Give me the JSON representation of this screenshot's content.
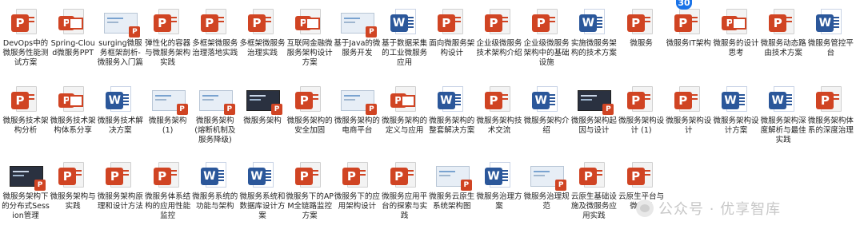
{
  "files": [
    {
      "label": "DevOps中的微服务性能测试方案",
      "type": "ppt"
    },
    {
      "label": "Spring-Cloud微服务PPT",
      "type": "pslide"
    },
    {
      "label": "surging微服务框架剖析-微服务入门篇",
      "type": "thumb-light"
    },
    {
      "label": "弹性化的容器与微服务架构实践",
      "type": "ppt"
    },
    {
      "label": "多框架微服务治理落地实践",
      "type": "ppt"
    },
    {
      "label": "多框架微服务治理实践",
      "type": "ppt"
    },
    {
      "label": "互联网金融微服务架构设计方案",
      "type": "pslide"
    },
    {
      "label": "基于Java的微服务开发",
      "type": "thumb-light"
    },
    {
      "label": "基于数据采集的工业微服务应用",
      "type": "word"
    },
    {
      "label": "面向微服务架构设计",
      "type": "ppt"
    },
    {
      "label": "企业级微服务技术架构介绍",
      "type": "ppt"
    },
    {
      "label": "企业级微服务架构中的基础设施",
      "type": "ppt"
    },
    {
      "label": "实施微服务架构的技术方案",
      "type": "word"
    },
    {
      "label": "微服务",
      "type": "ppt"
    },
    {
      "label": "微服务IT架构",
      "type": "ppt"
    },
    {
      "label": "微服务的设计思考",
      "type": "pslide"
    },
    {
      "label": "微服务动态路由技术方案",
      "type": "ppt"
    },
    {
      "label": "微服务管控平台",
      "type": "word"
    },
    {
      "label": "微服务技术架构分析",
      "type": "ppt"
    },
    {
      "label": "微服务技术架构体系分享",
      "type": "pslide"
    },
    {
      "label": "微服务技术解决方案",
      "type": "word"
    },
    {
      "label": "微服务架构(1)",
      "type": "thumb-light"
    },
    {
      "label": "微服务架构(熔断机制及服务降级)",
      "type": "thumb-light"
    },
    {
      "label": "微服务架构",
      "type": "thumb-dark"
    },
    {
      "label": "微服务架构的安全加固",
      "type": "ppt"
    },
    {
      "label": "微服务架构的电商平台",
      "type": "thumb-light"
    },
    {
      "label": "微服务架构的定义与应用",
      "type": "pslide"
    },
    {
      "label": "微服务架构的整套解决方案",
      "type": "word"
    },
    {
      "label": "微服务架构技术交流",
      "type": "ppt"
    },
    {
      "label": "微服务架构介绍",
      "type": "word"
    },
    {
      "label": "微服务架构起因与设计",
      "type": "thumb-dark"
    },
    {
      "label": "微服务架构设计 (1)",
      "type": "ppt"
    },
    {
      "label": "微服务架构设计",
      "type": "ppt"
    },
    {
      "label": "微服务架构设计方案",
      "type": "word"
    },
    {
      "label": "微服务架构深度解析与最佳实践",
      "type": "word"
    },
    {
      "label": "微服务架构体系的深度治理",
      "type": "ppt"
    },
    {
      "label": "微服务架构下的分布式Session管理",
      "type": "thumb-dark"
    },
    {
      "label": "微服务架构与实践",
      "type": "ppt"
    },
    {
      "label": "微服务架构原理和设计方法",
      "type": "ppt"
    },
    {
      "label": "微服务体系结构的应用性能监控",
      "type": "ppt"
    },
    {
      "label": "微服务系统的功能与架构",
      "type": "word"
    },
    {
      "label": "微服务系统和数据库设计方案",
      "type": "word"
    },
    {
      "label": "微服务下的APM全链路监控方案",
      "type": "ppt"
    },
    {
      "label": "微服务下的应用架构设计",
      "type": "ppt"
    },
    {
      "label": "微服务应用平台的探索与实践",
      "type": "ppt"
    },
    {
      "label": "微服务云原生系统架构图",
      "type": "thumb-light"
    },
    {
      "label": "微服务治理方案",
      "type": "word-thumb"
    },
    {
      "label": "微服务治理规范",
      "type": "thumb-light"
    },
    {
      "label": "云原生基础设施及微服务应用实践",
      "type": "ppt"
    },
    {
      "label": "云原生平台与微服务",
      "type": "ppt"
    }
  ],
  "watermark": "公众号 · 优享智库",
  "floating_badge": "30"
}
